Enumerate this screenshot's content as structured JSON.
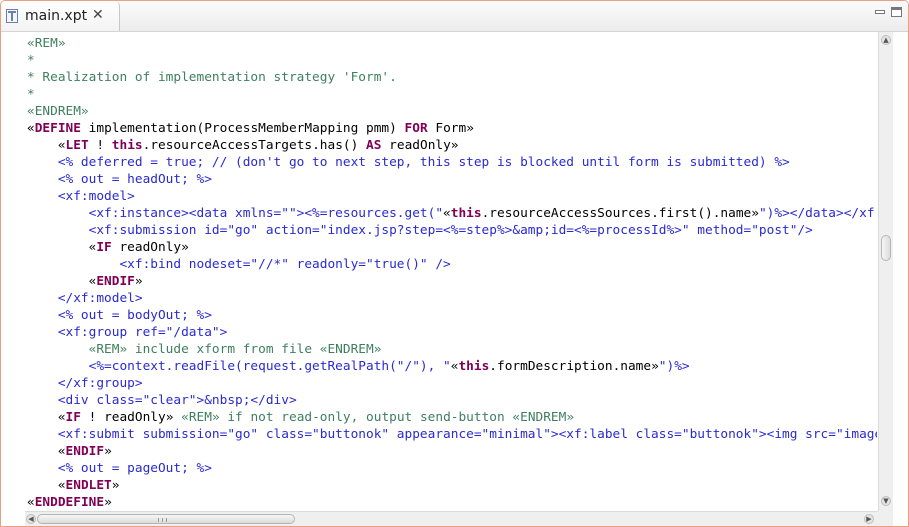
{
  "tab": {
    "label": "main.xpt",
    "close_glyph": "✕"
  },
  "view_controls": {
    "minimize": "minimize",
    "maximize": "maximize"
  },
  "colors": {
    "comment": "#3f7f5f",
    "keyword": "#7f0055",
    "tag": "#2a2ad0",
    "text": "#000000"
  },
  "code_lines": [
    [
      [
        "com",
        "«REM»"
      ]
    ],
    [
      [
        "com",
        "*"
      ]
    ],
    [
      [
        "com",
        "* Realization of implementation strategy 'Form'."
      ]
    ],
    [
      [
        "com",
        "*"
      ]
    ],
    [
      [
        "com",
        "«ENDREM»"
      ]
    ],
    [
      [
        "plain",
        "«"
      ],
      [
        "kw",
        "DEFINE"
      ],
      [
        "plain",
        " implementation(ProcessMemberMapping pmm) "
      ],
      [
        "kw",
        "FOR"
      ],
      [
        "plain",
        " Form»"
      ]
    ],
    [
      [
        "plain",
        "    «"
      ],
      [
        "kw",
        "LET"
      ],
      [
        "plain",
        " ! "
      ],
      [
        "kw",
        "this"
      ],
      [
        "plain",
        ".resourceAccessTargets.has() "
      ],
      [
        "kw",
        "AS"
      ],
      [
        "plain",
        " readOnly»"
      ]
    ],
    [
      [
        "tag",
        "    <% deferred = true; // (don't go to next step, this step is blocked until form is submitted) %>"
      ]
    ],
    [
      [
        "tag",
        "    <% out = headOut; %>"
      ]
    ],
    [
      [
        "tag",
        "    <xf:model>"
      ]
    ],
    [
      [
        "tag",
        "        <xf:instance><data xmlns=\"\"><%=resources.get(\""
      ],
      [
        "plain",
        "«"
      ],
      [
        "kw",
        "this"
      ],
      [
        "plain",
        ".resourceAccessSources.first().name»"
      ],
      [
        "tag",
        "\")%></data></xf:instance>"
      ]
    ],
    [
      [
        "tag",
        "        <xf:submission id=\"go\" action=\"index.jsp?step=<%=step%>&amp;id=<%=processId%>\" method=\"post\"/>"
      ]
    ],
    [
      [
        "plain",
        "        «"
      ],
      [
        "kw",
        "IF"
      ],
      [
        "plain",
        " readOnly»"
      ]
    ],
    [
      [
        "tag",
        "            <xf:bind nodeset=\"//*\" readonly=\"true()\" />"
      ]
    ],
    [
      [
        "plain",
        "        «"
      ],
      [
        "kw",
        "ENDIF"
      ],
      [
        "plain",
        "»"
      ]
    ],
    [
      [
        "tag",
        "    </xf:model>"
      ]
    ],
    [
      [
        "tag",
        "    <% out = bodyOut; %>"
      ]
    ],
    [
      [
        "tag",
        "    <xf:group ref=\"/data\">"
      ]
    ],
    [
      [
        "com",
        "        «REM» include xform from file «ENDREM»"
      ]
    ],
    [
      [
        "tag",
        "        <%=context.readFile(request.getRealPath(\"/\"), \""
      ],
      [
        "plain",
        "«"
      ],
      [
        "kw",
        "this"
      ],
      [
        "plain",
        ".formDescription.name»"
      ],
      [
        "tag",
        "\")%>"
      ]
    ],
    [
      [
        "tag",
        "    </xf:group>"
      ]
    ],
    [
      [
        "tag",
        "    <div class=\"clear\">&nbsp;</div>"
      ]
    ],
    [
      [
        "plain",
        "    «"
      ],
      [
        "kw",
        "IF"
      ],
      [
        "plain",
        " ! readOnly» "
      ],
      [
        "com",
        "«REM» if not read-only, output send-button «ENDREM»"
      ]
    ],
    [
      [
        "tag",
        "    <xf:submit submission=\"go\" class=\"buttonok\" appearance=\"minimal\"><xf:label class=\"buttonok\"><img src=\"images/ok.png\"/></xf:label></xf:submit>"
      ]
    ],
    [
      [
        "plain",
        "    «"
      ],
      [
        "kw",
        "ENDIF"
      ],
      [
        "plain",
        "»"
      ]
    ],
    [
      [
        "tag",
        "    <% out = pageOut; %>"
      ]
    ],
    [
      [
        "plain",
        "    «"
      ],
      [
        "kw",
        "ENDLET"
      ],
      [
        "plain",
        "»"
      ]
    ],
    [
      [
        "plain",
        "«"
      ],
      [
        "kw",
        "ENDDEFINE"
      ],
      [
        "plain",
        "»"
      ]
    ]
  ]
}
